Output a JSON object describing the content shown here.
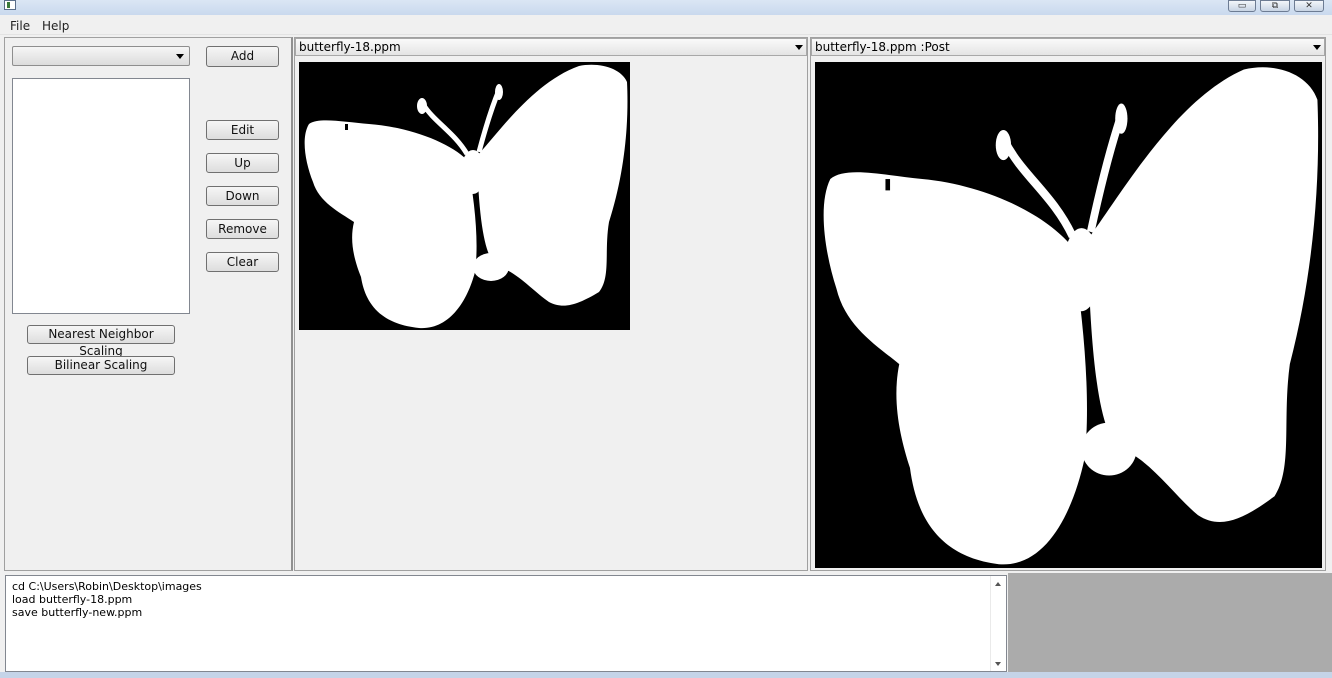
{
  "window": {
    "title": "",
    "controls": [
      "minimize-icon",
      "restore-icon",
      "close-icon"
    ]
  },
  "menu": {
    "items": [
      "File",
      "Help"
    ]
  },
  "left_panel": {
    "dropdown_value": "",
    "buttons": {
      "add": "Add",
      "edit": "Edit",
      "up": "Up",
      "down": "Down",
      "remove": "Remove",
      "clear": "Clear"
    },
    "scaling_buttons": {
      "nearest": "Nearest Neighbor Scaling",
      "bilinear": "Bilinear Scaling"
    }
  },
  "viewer_left": {
    "title": "butterfly-18.ppm"
  },
  "viewer_right": {
    "title": "butterfly-18.ppm :Post"
  },
  "console": {
    "lines": [
      "cd C:\\Users\\Robin\\Desktop\\images",
      "load butterfly-18.ppm",
      "save butterfly-new.ppm"
    ]
  },
  "colors": {
    "image_background": "#000000",
    "image_foreground": "#ffffff",
    "gray_area": "#ababab"
  }
}
